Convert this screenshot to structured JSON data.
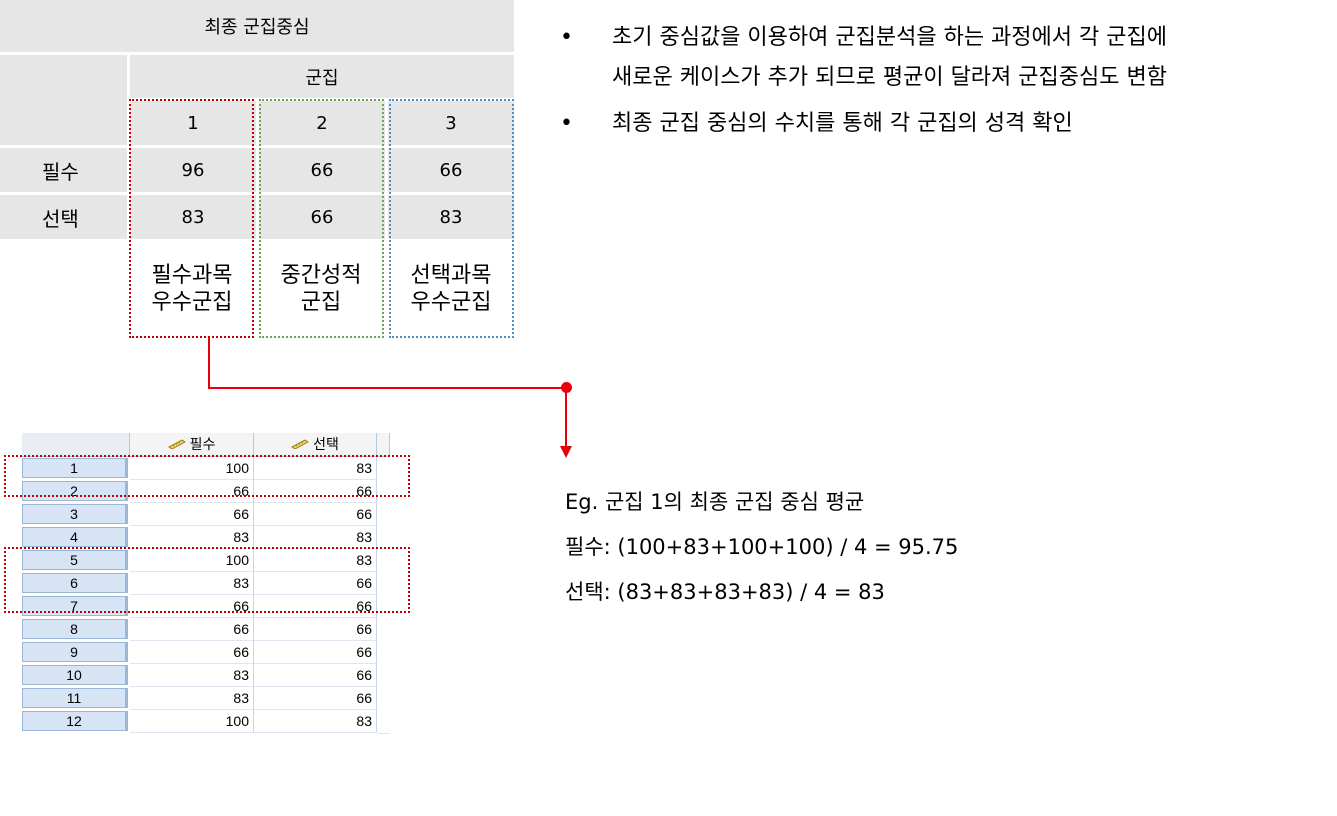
{
  "centers_table": {
    "title": "최종 군집중심",
    "cluster_header": "군집",
    "cluster_numbers": [
      "1",
      "2",
      "3"
    ],
    "rows": [
      {
        "label": "필수",
        "values": [
          "96",
          "66",
          "66"
        ]
      },
      {
        "label": "선택",
        "values": [
          "83",
          "66",
          "83"
        ]
      }
    ],
    "captions": [
      {
        "line1": "필수과목",
        "line2": "우수군집"
      },
      {
        "line1": "중간성적",
        "line2": "군집"
      },
      {
        "line1": "선택과목",
        "line2": "우수군집"
      }
    ],
    "colors": {
      "red": "#c00000",
      "green": "#6aa84f",
      "blue": "#4a90c8",
      "connector": "#e8000b"
    }
  },
  "bullets": [
    {
      "symbol": "•",
      "line1": "초기 중심값을 이용하여 군집분석을 하는 과정에서 각 군집에",
      "line2": "새로운 케이스가 추가 되므로 평균이 달라져 군집중심도 변함"
    },
    {
      "symbol": "•",
      "line1": "최종 군집 중심의 수치를 통해 각 군집의 성격 확인",
      "line2": ""
    }
  ],
  "data_view": {
    "columns": [
      "필수",
      "선택"
    ],
    "column_icon": "ruler-icon",
    "rows": [
      {
        "n": "1",
        "a": "100",
        "b": "83"
      },
      {
        "n": "2",
        "a": "66",
        "b": "66"
      },
      {
        "n": "3",
        "a": "66",
        "b": "66"
      },
      {
        "n": "4",
        "a": "83",
        "b": "83"
      },
      {
        "n": "5",
        "a": "100",
        "b": "83"
      },
      {
        "n": "6",
        "a": "83",
        "b": "66"
      },
      {
        "n": "7",
        "a": "66",
        "b": "66"
      },
      {
        "n": "8",
        "a": "66",
        "b": "66"
      },
      {
        "n": "9",
        "a": "66",
        "b": "66"
      },
      {
        "n": "10",
        "a": "83",
        "b": "66"
      },
      {
        "n": "11",
        "a": "83",
        "b": "66"
      },
      {
        "n": "12",
        "a": "100",
        "b": "83"
      }
    ]
  },
  "example": {
    "line1": "Eg. 군집 1의 최종 군집 중심 평균",
    "line2": "필수: (100+83+100+100) / 4 = 95.75",
    "line3": "선택: (83+83+83+83) / 4 = 83"
  }
}
